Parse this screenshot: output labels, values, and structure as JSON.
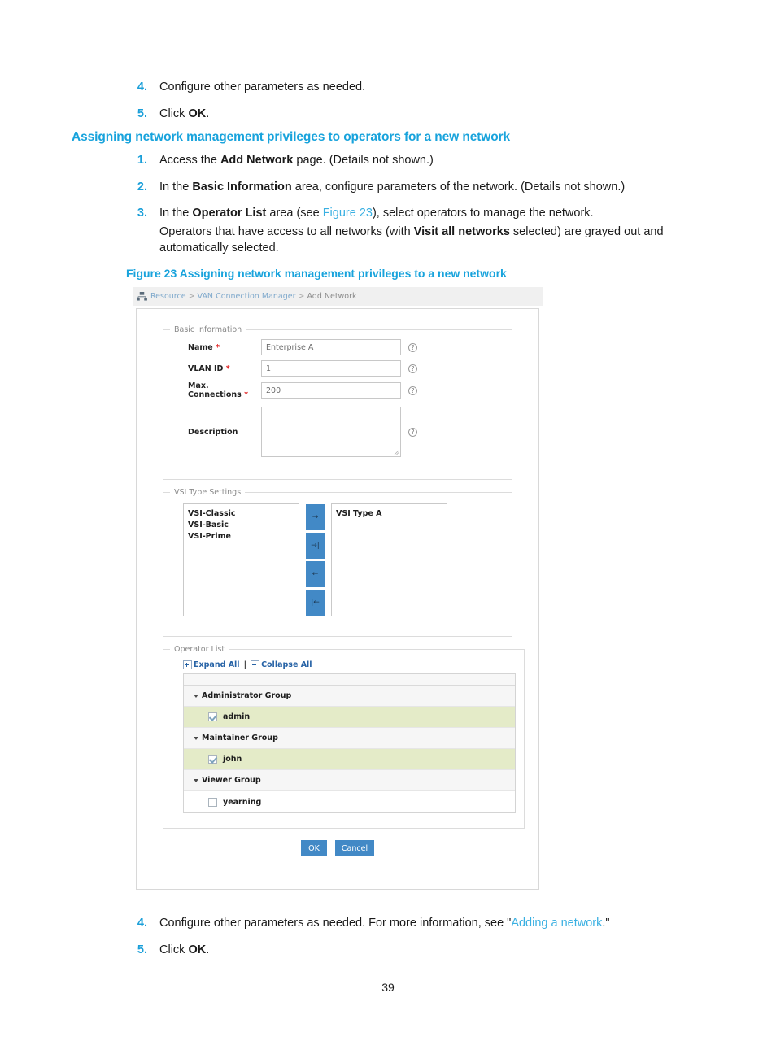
{
  "document": {
    "page_number": "39",
    "steps_top": [
      {
        "num": "4.",
        "text": "Configure other parameters as needed."
      },
      {
        "num": "5.",
        "text_pre": "Click ",
        "bold": "OK",
        "text_post": "."
      }
    ],
    "section_heading": "Assigning network management privileges to operators for a new network",
    "steps_mid": [
      {
        "num": "1.",
        "pre": "Access the ",
        "bold": "Add Network",
        "post": " page. (Details not shown.)"
      },
      {
        "num": "2.",
        "pre": "In the ",
        "bold": "Basic Information",
        "post": " area, configure parameters of the network. (Details not shown.)"
      },
      {
        "num": "3.",
        "pre": "In the ",
        "bold": "Operator List",
        "mid": " area (see ",
        "link": "Figure 23",
        "post": "), select operators to manage the network."
      }
    ],
    "note_paragraph": {
      "pre": "Operators that have access to all networks (with ",
      "bold": "Visit all networks",
      "post": " selected) are grayed out and automatically selected."
    },
    "figure_caption": "Figure 23 Assigning network management privileges to a new network",
    "steps_bottom": [
      {
        "num": "4.",
        "pre": "Configure other parameters as needed. For more information, see \"",
        "link": "Adding a network",
        "post": ".\""
      },
      {
        "num": "5.",
        "pre": "Click ",
        "bold": "OK",
        "post": "."
      }
    ]
  },
  "screenshot": {
    "breadcrumb": {
      "icon": "network-topology-icon",
      "root": "Resource",
      "sep": ">",
      "second": "VAN Connection Manager",
      "current": "Add Network"
    },
    "basic_information": {
      "legend": "Basic Information",
      "fields": [
        {
          "label": "Name",
          "required": "*",
          "value": "Enterprise A",
          "help": "?"
        },
        {
          "label": "VLAN ID",
          "required": "*",
          "value": "1",
          "help": "?"
        },
        {
          "label": "Max. Connections",
          "required": "*",
          "value": "200",
          "help": "?"
        },
        {
          "label": "Description",
          "required": "",
          "value": "",
          "help": "?"
        }
      ]
    },
    "vsi_type_settings": {
      "legend": "VSI Type Settings",
      "available": [
        "VSI-Classic",
        "VSI-Basic",
        "VSI-Prime"
      ],
      "selected": [
        "VSI Type A"
      ],
      "transfer_buttons": [
        {
          "name": "move-right-button",
          "glyph": "→"
        },
        {
          "name": "move-all-right-button",
          "glyph": "→|"
        },
        {
          "name": "move-left-button",
          "glyph": "←"
        },
        {
          "name": "move-all-left-button",
          "glyph": "|←"
        }
      ]
    },
    "operator_list": {
      "legend": "Operator List",
      "expand_all": "Expand All",
      "collapse_all": "Collapse All",
      "separator": "|",
      "rows": [
        {
          "type": "group",
          "label": "Administrator Group"
        },
        {
          "type": "leaf",
          "label": "admin",
          "checked": true
        },
        {
          "type": "group",
          "label": "Maintainer Group"
        },
        {
          "type": "leaf",
          "label": "john",
          "checked": true
        },
        {
          "type": "group",
          "label": "Viewer Group"
        },
        {
          "type": "leaf",
          "label": "yearning",
          "checked": false
        }
      ]
    },
    "actions": {
      "ok": "OK",
      "cancel": "Cancel"
    },
    "colors": {
      "accent_blue": "#18a3dc",
      "button_blue": "#4289c6",
      "checked_row": "#e4ebc8",
      "group_row": "#f6f6f6",
      "link_blue": "#2763a6",
      "required_red": "#e02020"
    }
  }
}
